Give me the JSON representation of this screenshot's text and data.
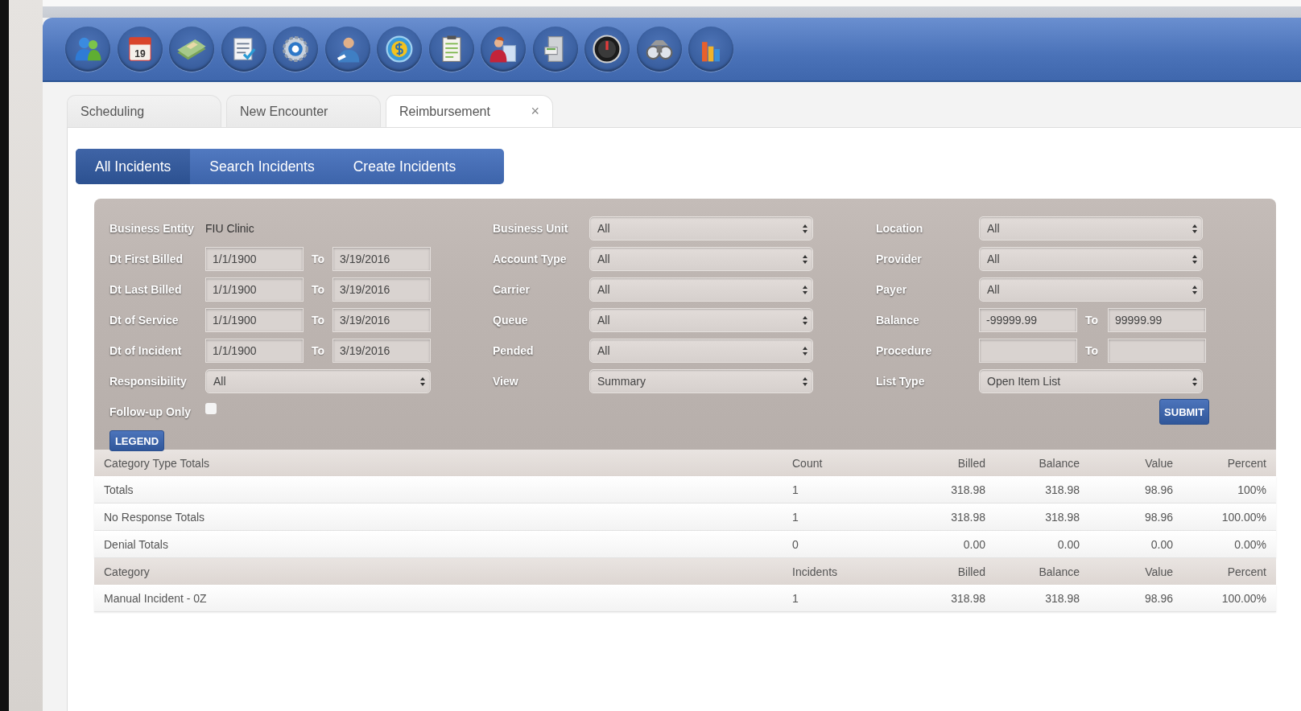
{
  "toolbar": {
    "icons": [
      {
        "kind": "people"
      },
      {
        "kind": "calendar",
        "text": "19"
      },
      {
        "kind": "money"
      },
      {
        "kind": "checklist"
      },
      {
        "kind": "gear"
      },
      {
        "kind": "person"
      },
      {
        "kind": "coin"
      },
      {
        "kind": "clipboard"
      },
      {
        "kind": "person-document"
      },
      {
        "kind": "cabinet"
      },
      {
        "kind": "gauge"
      },
      {
        "kind": "binoculars"
      },
      {
        "kind": "bar-chart"
      }
    ]
  },
  "tabs": [
    {
      "label": "Scheduling",
      "selected": false
    },
    {
      "label": "New Encounter",
      "selected": false
    },
    {
      "label": "Reimbursement",
      "selected": true,
      "close": "×"
    }
  ],
  "subtabs": [
    {
      "label": "All Incidents",
      "selected": true
    },
    {
      "label": "Search Incidents",
      "selected": false
    },
    {
      "label": "Create Incidents",
      "selected": false
    }
  ],
  "filters": {
    "columns": [
      {
        "rows": [
          {
            "kind": "text",
            "label": "Business Entity",
            "value": "FIU Clinic"
          },
          {
            "kind": "range",
            "label": "Dt First Billed",
            "from": "1/1/1900",
            "to_label": "To",
            "to": "3/19/2016"
          },
          {
            "kind": "range",
            "label": "Dt Last Billed",
            "from": "1/1/1900",
            "to_label": "To",
            "to": "3/19/2016"
          },
          {
            "kind": "range",
            "label": "Dt of Service",
            "from": "1/1/1900",
            "to_label": "To",
            "to": "3/19/2016"
          },
          {
            "kind": "range",
            "label": "Dt of Incident",
            "from": "1/1/1900",
            "to_label": "To",
            "to": "3/19/2016"
          },
          {
            "kind": "select",
            "label": "Responsibility",
            "value": "All"
          },
          {
            "kind": "checkbox",
            "label": "Follow-up Only",
            "checked": false
          }
        ]
      },
      {
        "rows": [
          {
            "kind": "select",
            "label": "Business Unit",
            "value": "All"
          },
          {
            "kind": "select",
            "label": "Account Type",
            "value": "All"
          },
          {
            "kind": "select",
            "label": "Carrier",
            "value": "All"
          },
          {
            "kind": "select",
            "label": "Queue",
            "value": "All"
          },
          {
            "kind": "select",
            "label": "Pended",
            "value": "All"
          },
          {
            "kind": "select",
            "label": "View",
            "value": "Summary"
          }
        ]
      },
      {
        "rows": [
          {
            "kind": "select",
            "label": "Location",
            "value": "All"
          },
          {
            "kind": "select",
            "label": "Provider",
            "value": "All"
          },
          {
            "kind": "select",
            "label": "Payer",
            "value": "All"
          },
          {
            "kind": "range",
            "label": "Balance",
            "from": "-99999.99",
            "to_label": "To",
            "to": "99999.99"
          },
          {
            "kind": "range",
            "label": "Procedure",
            "to_label": "To"
          },
          {
            "kind": "select",
            "label": "List Type",
            "value": "Open Item List"
          }
        ]
      }
    ],
    "legend_button": "LEGEND",
    "submit_button": "SUBMIT"
  },
  "table": {
    "sections": [
      {
        "columns": [
          "Category Type Totals",
          "Count",
          "Billed",
          "Balance",
          "Value",
          "Percent"
        ],
        "rows": [
          [
            "Totals",
            "1",
            "318.98",
            "318.98",
            "98.96",
            "100%"
          ],
          [
            "No Response Totals",
            "1",
            "318.98",
            "318.98",
            "98.96",
            "100.00%"
          ],
          [
            "Denial Totals",
            "0",
            "0.00",
            "0.00",
            "0.00",
            "0.00%"
          ]
        ]
      },
      {
        "columns": [
          "Category",
          "Incidents",
          "Billed",
          "Balance",
          "Value",
          "Percent"
        ],
        "rows": [
          [
            "Manual Incident - 0Z",
            "1",
            "318.98",
            "318.98",
            "98.96",
            "100.00%"
          ]
        ]
      }
    ]
  }
}
